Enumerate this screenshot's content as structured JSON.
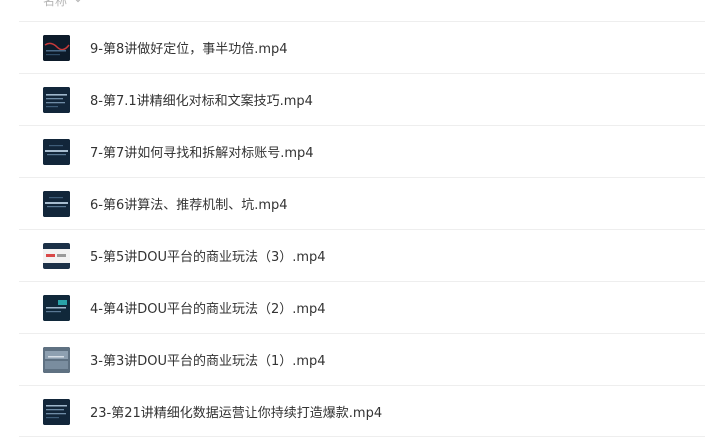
{
  "header": {
    "sort_label": "名称"
  },
  "files": [
    {
      "name": "9-第8讲做好定位，事半功倍.mp4",
      "thumb_style": "dark-red"
    },
    {
      "name": "8-第7.1讲精细化对标和文案技巧.mp4",
      "thumb_style": "dark-text"
    },
    {
      "name": "7-第7讲如何寻找和拆解对标账号.mp4",
      "thumb_style": "dark-text"
    },
    {
      "name": "6-第6讲算法、推荐机制、坑.mp4",
      "thumb_style": "dark-text"
    },
    {
      "name": "5-第5讲DOU平台的商业玩法（3）.mp4",
      "thumb_style": "light-slide"
    },
    {
      "name": "4-第4讲DOU平台的商业玩法（2）.mp4",
      "thumb_style": "dark-teal"
    },
    {
      "name": "3-第3讲DOU平台的商业玩法（1）.mp4",
      "thumb_style": "grey-blur"
    },
    {
      "name": "23-第21讲精细化数据运营让你持续打造爆款.mp4",
      "thumb_style": "dark-text"
    }
  ],
  "colors": {
    "text": "#333333",
    "divider": "#eeeeee",
    "header_text": "#b5b5b5",
    "thumb_bg": "#0f2233"
  }
}
